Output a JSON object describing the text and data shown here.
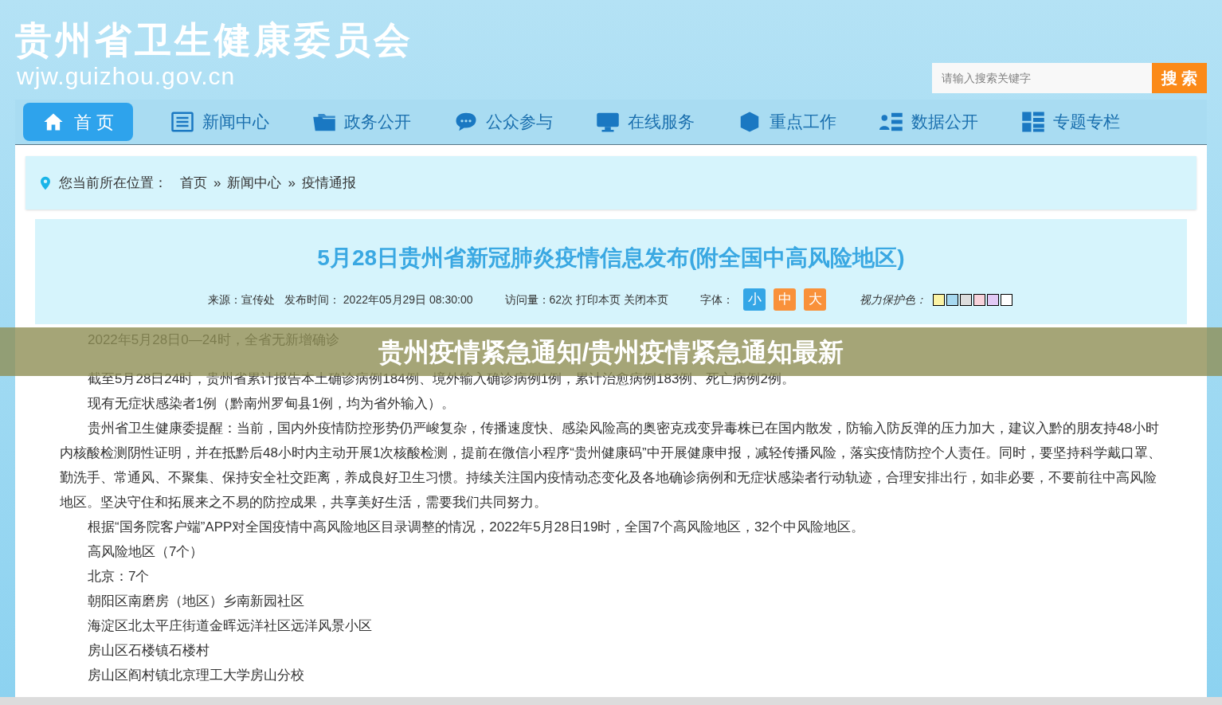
{
  "header": {
    "site_title": "贵州省卫生健康委员会",
    "domain": "wjw.guizhou.gov.cn",
    "search": {
      "placeholder": "请输入搜索关键字",
      "button": "搜 索"
    }
  },
  "nav": [
    {
      "label": "首 页",
      "selected": true
    },
    {
      "label": "新闻中心",
      "selected": false
    },
    {
      "label": "政务公开",
      "selected": false
    },
    {
      "label": "公众参与",
      "selected": false
    },
    {
      "label": "在线服务",
      "selected": false
    },
    {
      "label": "重点工作",
      "selected": false
    },
    {
      "label": "数据公开",
      "selected": false
    },
    {
      "label": "专题专栏",
      "selected": false
    }
  ],
  "breadcrumb": {
    "label": "您当前所在位置：",
    "items": [
      "首页",
      "新闻中心",
      "疫情通报"
    ],
    "separator": "»"
  },
  "article": {
    "title": "5月28日贵州省新冠肺炎疫情信息发布(附全国中高风险地区)",
    "meta": {
      "source": "来源：宣传处",
      "published": "发布时间： 2022年05月29日 08:30:00",
      "views": "访问量：62次",
      "print": "打印本页",
      "close": "关闭本页",
      "font_label": "字体：",
      "font_sizes": [
        {
          "label": "小",
          "selected": true
        },
        {
          "label": "中",
          "selected": false
        },
        {
          "label": "大",
          "selected": false
        }
      ],
      "eye_care_label": "视力保护色：",
      "eye_care_colors": [
        {
          "color": "#fbf3a4"
        },
        {
          "color": "#a6d8f0"
        },
        {
          "color": "#dddddd"
        },
        {
          "color": "#f8d3dc"
        },
        {
          "color": "#e2c9f5"
        },
        {
          "color": "#ffffff"
        }
      ]
    },
    "paragraphs": [
      "2022年5月28日0—24时，全省无新增确诊",
      "截至5月28日24时，贵州省累计报告本土确诊病例184例、境外输入确诊病例1例，累计治愈病例183例、死亡病例2例。",
      "现有无症状感染者1例（黔南州罗甸县1例，均为省外输入）。",
      "贵州省卫生健康委提醒：当前，国内外疫情防控形势仍严峻复杂，传播速度快、感染风险高的奥密克戎变异毒株已在国内散发，防输入防反弹的压力加大，建议入黔的朋友持48小时内核酸检测阴性证明，并在抵黔后48小时内主动开展1次核酸检测，提前在微信小程序“贵州健康码”中开展健康申报，减轻传播风险，落实疫情防控个人责任。同时，要坚持科学戴口罩、勤洗手、常通风、不聚集、保持安全社交距离，养成良好卫生习惯。持续关注国内疫情动态变化及各地确诊病例和无症状感染者行动轨迹，合理安排出行，如非必要，不要前往中高风险地区。坚决守住和拓展来之不易的防控成果，共享美好生活，需要我们共同努力。",
      "根据“国务院客户端”APP对全国疫情中高风险地区目录调整的情况，2022年5月28日19时，全国7个高风险地区，32个中风险地区。",
      "高风险地区（7个）",
      "北京：7个",
      "朝阳区南磨房（地区）乡南新园社区",
      "海淀区北太平庄街道金晖远洋社区远洋风景小区",
      "房山区石楼镇石楼村",
      "房山区阎村镇北京理工大学房山分校"
    ]
  },
  "overlay_banner": "贵州疫情紧急通知/贵州疫情紧急通知最新"
}
